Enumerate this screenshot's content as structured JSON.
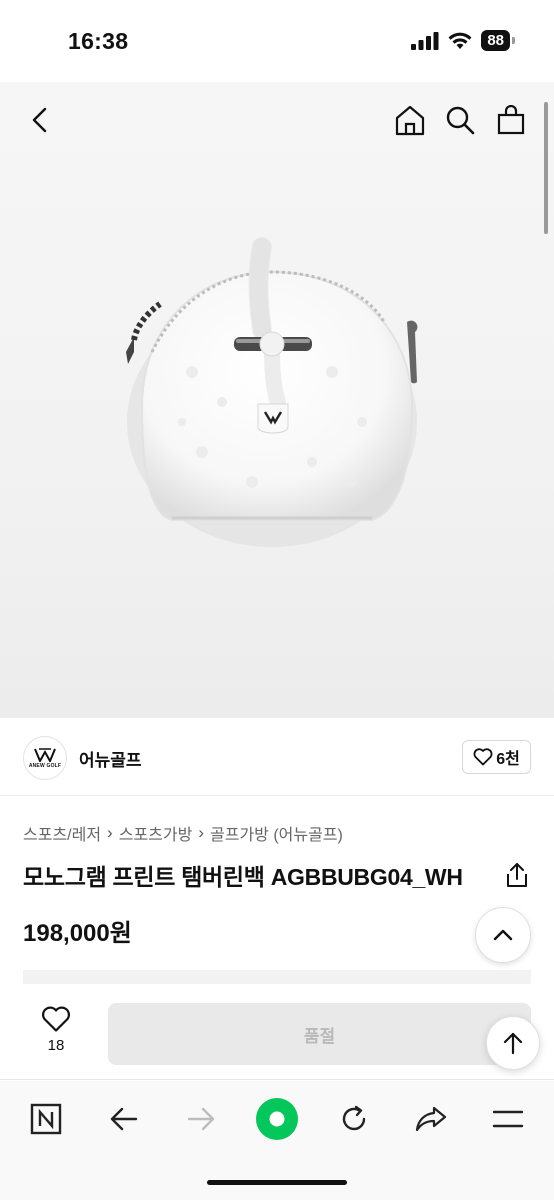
{
  "status_bar": {
    "time": "16:38",
    "battery": "88"
  },
  "header": {
    "back_icon": "chevron-left-icon",
    "home_icon": "home-icon",
    "search_icon": "search-icon",
    "cart_icon": "shopping-bag-icon"
  },
  "seller": {
    "logo_text": "ANEW GOLF",
    "name": "어뉴골프",
    "like_count": "6천"
  },
  "breadcrumb": [
    "스포츠/레저",
    "스포츠가방",
    "골프가방 (어뉴골프)"
  ],
  "product": {
    "title": "모노그램 프린트 탬버린백 AGBBUBG04_WH",
    "price": "198,000원"
  },
  "action_bar": {
    "wish_count": "18",
    "soldout_label": "품절"
  },
  "browser_toolbar": [
    "n-logo-icon",
    "arrow-left-icon",
    "arrow-right-icon",
    "green-dot-icon",
    "reload-icon",
    "share-arrow-icon",
    "menu-icon"
  ],
  "colors": {
    "accent_green": "#03c75a",
    "soldout_bg": "#e9e9e9",
    "soldout_text": "#b9b9b9"
  }
}
